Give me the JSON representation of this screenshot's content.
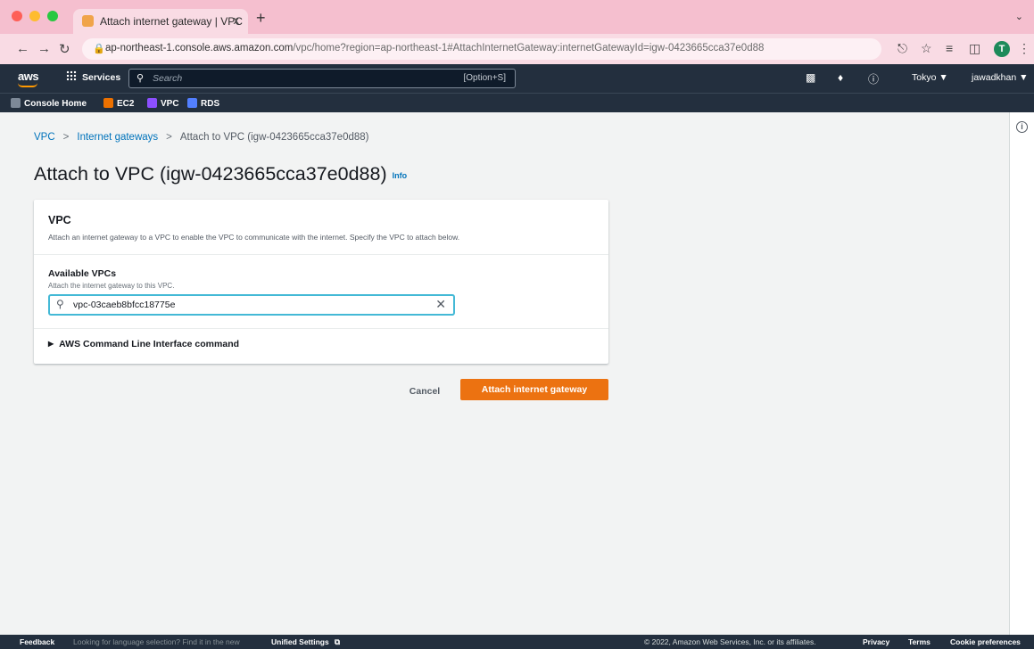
{
  "browser": {
    "tab_title": "Attach internet gateway | VPC",
    "tab_close": "x",
    "new_tab": "+",
    "url_host": "ap-northeast-1.console.aws.amazon.com",
    "url_path": "/vpc/home?region=ap-northeast-1#AttachInternetGateway:internetGatewayId=igw-0423665cca37e0d88",
    "profile_initial": "T"
  },
  "aws_nav": {
    "logo": "aws",
    "services_label": "Services",
    "search_placeholder": "Search",
    "search_shortcut": "[Option+S]",
    "region": "Tokyo ▼",
    "user": "jawadkhan ▼"
  },
  "favorites": [
    {
      "label": "Console Home",
      "color": "#7d8998"
    },
    {
      "label": "EC2",
      "color": "#ed7100"
    },
    {
      "label": "VPC",
      "color": "#8c4fff"
    },
    {
      "label": "RDS",
      "color": "#527fff"
    }
  ],
  "breadcrumb": {
    "items": [
      "VPC",
      "Internet gateways"
    ],
    "current": "Attach to VPC (igw-0423665cca37e0d88)",
    "separator": ">"
  },
  "page": {
    "title": "Attach to VPC (igw-0423665cca37e0d88)",
    "info_label": "Info"
  },
  "vpc_panel": {
    "title": "VPC",
    "description": "Attach an internet gateway to a VPC to enable the VPC to communicate with the internet. Specify the VPC to attach below.",
    "field_label": "Available VPCs",
    "field_description": "Attach the internet gateway to this VPC.",
    "field_value": "vpc-03caeb8bfcc18775e",
    "cli_label": "AWS Command Line Interface command"
  },
  "actions": {
    "cancel": "Cancel",
    "attach": "Attach internet gateway"
  },
  "footer": {
    "feedback": "Feedback",
    "language_prompt": "Looking for language selection? Find it in the new",
    "unified_settings": "Unified Settings",
    "copyright": "© 2022, Amazon Web Services, Inc. or its affiliates.",
    "privacy": "Privacy",
    "terms": "Terms",
    "cookies": "Cookie preferences"
  },
  "colors": {
    "aws_nav_bg": "#232f3e",
    "primary_button": "#ec7211",
    "link": "#0073bb",
    "focus_ring": "#44b9d6",
    "browser_tab_strip": "#f5bfcf"
  }
}
